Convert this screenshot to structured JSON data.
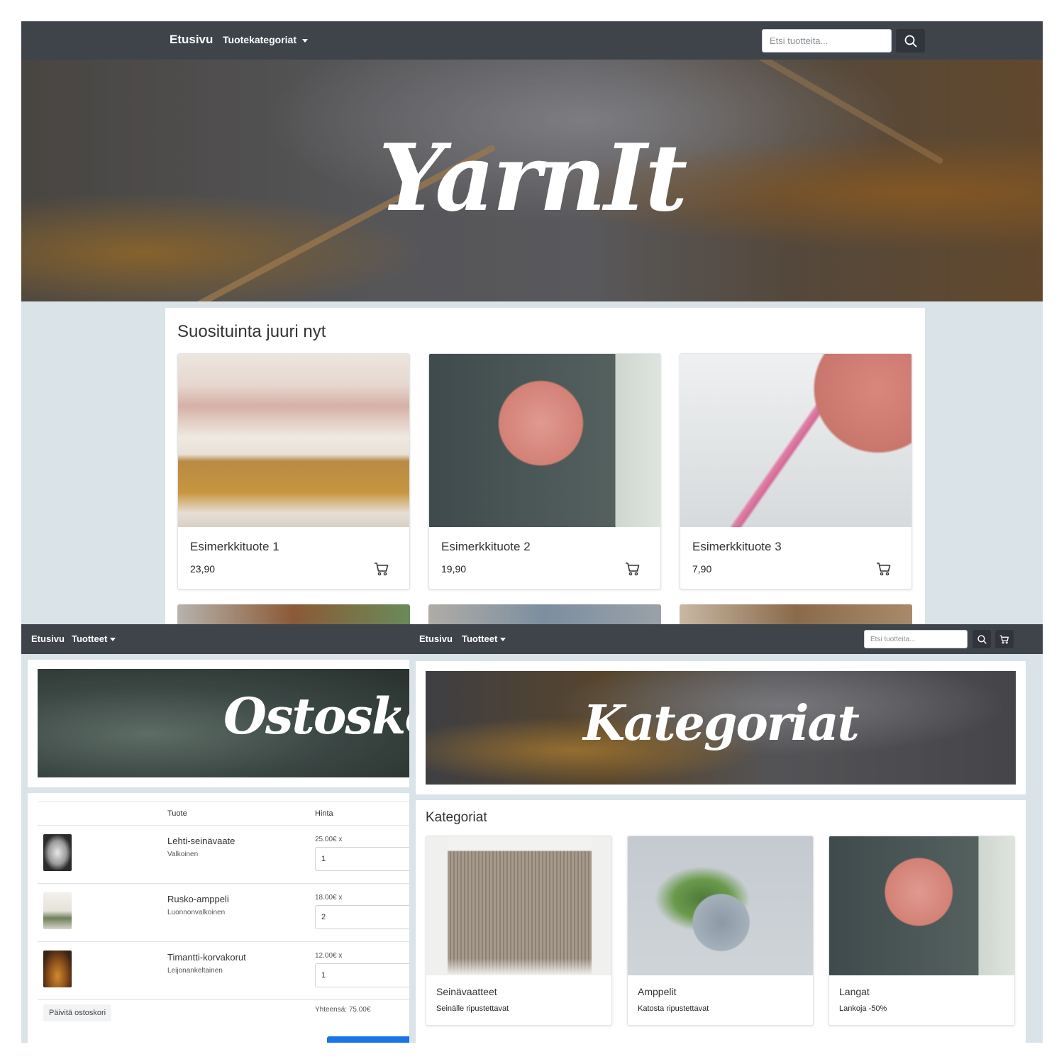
{
  "main": {
    "nav": {
      "brand": "Etusivu",
      "categories_label": "Tuotekategoriat",
      "search_placeholder": "Etsi tuotteita..."
    },
    "hero_title": "YarnIt",
    "section_title": "Suosituinta juuri nyt",
    "products": [
      {
        "name": "Esimerkkituote 1",
        "price": "23,90"
      },
      {
        "name": "Esimerkkituote 2",
        "price": "19,90"
      },
      {
        "name": "Esimerkkituote 3",
        "price": "7,90"
      }
    ]
  },
  "cart_page": {
    "nav": {
      "home": "Etusivu",
      "products": "Tuotteet"
    },
    "banner_title": "Ostoskori",
    "columns": {
      "product": "Tuote",
      "price": "Hinta"
    },
    "items": [
      {
        "name": "Lehti-seinävaate",
        "variant": "Valkoinen",
        "unit_price": "25.00€ x",
        "quantity": "1"
      },
      {
        "name": "Rusko-amppeli",
        "variant": "Luonnonvalkoinen",
        "unit_price": "18.00€ x",
        "quantity": "2"
      },
      {
        "name": "Timantti-korvakorut",
        "variant": "Leijonankeltainen",
        "unit_price": "12.00€ x",
        "quantity": "1"
      }
    ],
    "update_label": "Päivitä ostoskori",
    "total": "Yhteensä: 75.00€"
  },
  "categories_page": {
    "nav": {
      "home": "Etusivu",
      "products": "Tuotteet",
      "search_placeholder": "Etsi tuotteita..."
    },
    "banner_title": "Kategoriat",
    "section_title": "Kategoriat",
    "categories": [
      {
        "name": "Seinävaatteet",
        "description": "Seinälle ripustettavat"
      },
      {
        "name": "Amppelit",
        "description": "Katosta ripustettavat"
      },
      {
        "name": "Langat",
        "description": "Lankoja -50%"
      }
    ]
  },
  "colors": {
    "navbar": "#3f444b",
    "page_background": "#d9e3e8",
    "primary_button": "#1a73e8",
    "yarn_pink": "#d88a80"
  },
  "icons": [
    "search-icon",
    "shopping-cart-icon",
    "caret-down-icon"
  ]
}
